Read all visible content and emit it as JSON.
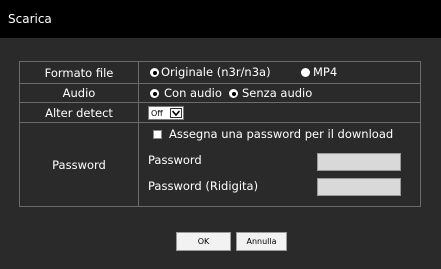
{
  "window": {
    "title": "Scarica"
  },
  "colors": {
    "background": "#2a2a2a",
    "titlebar": "#000000",
    "text": "#ffffff",
    "border": "#6b6b6b",
    "input_bg": "#d9d9d9"
  },
  "form": {
    "formato_file": {
      "label": "Formato file",
      "options": [
        "Originale (n3r/n3a)",
        "MP4"
      ],
      "selected": "Originale (n3r/n3a)"
    },
    "audio": {
      "label": "Audio",
      "options": [
        "Con audio",
        "Senza audio"
      ],
      "selected": "Con audio"
    },
    "alter_detect": {
      "label": "Alter detect",
      "value": "Off"
    },
    "password": {
      "label": "Password",
      "checkbox_label": "Assegna una password per il download",
      "checked": false,
      "field_label": "Password",
      "confirm_label": "Password (Ridigita)",
      "value": "",
      "confirm_value": ""
    }
  },
  "buttons": {
    "ok": "OK",
    "cancel": "Annulla"
  }
}
